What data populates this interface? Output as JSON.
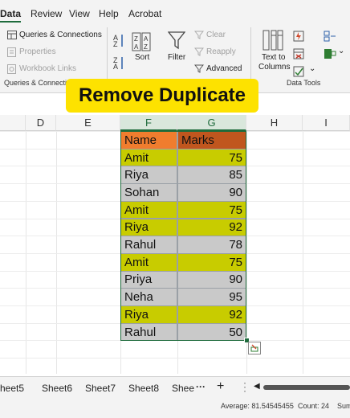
{
  "menu": [
    "Data",
    "Review",
    "View",
    "Help",
    "Acrobat"
  ],
  "ribbon": {
    "queries_connections": "Queries & Connections",
    "properties": "Properties",
    "workbook_links": "Workbook Links",
    "group_queries": "Queries & Connectio",
    "sort": "Sort",
    "filter": "Filter",
    "clear": "Clear",
    "reapply": "Reapply",
    "advanced": "Advanced",
    "text_to": "Text to",
    "columns": "Columns",
    "group_data_tools": "Data Tools",
    "az_top": "A\nZ",
    "za_top": "Z\nA"
  },
  "banner": "Remove Duplicate",
  "columns": [
    "D",
    "E",
    "F",
    "G",
    "H",
    "I"
  ],
  "table": {
    "header_name": "Name",
    "header_marks": "Marks",
    "rows": [
      {
        "name": "Amit",
        "marks": "75",
        "duplicate": true
      },
      {
        "name": "Riya",
        "marks": "85",
        "duplicate": false
      },
      {
        "name": "Sohan",
        "marks": "90",
        "duplicate": false
      },
      {
        "name": "Amit",
        "marks": "75",
        "duplicate": true
      },
      {
        "name": "Riya",
        "marks": "92",
        "duplicate": true
      },
      {
        "name": "Rahul",
        "marks": "78",
        "duplicate": false
      },
      {
        "name": "Amit",
        "marks": "75",
        "duplicate": true
      },
      {
        "name": "Priya",
        "marks": "90",
        "duplicate": false
      },
      {
        "name": "Neha",
        "marks": "95",
        "duplicate": false
      },
      {
        "name": "Riya",
        "marks": "92",
        "duplicate": true
      },
      {
        "name": "Rahul",
        "marks": "50",
        "duplicate": false
      }
    ]
  },
  "sheets": [
    "heet5",
    "Sheet6",
    "Sheet7",
    "Sheet8",
    "Shee"
  ],
  "sheet_more": "···",
  "sheet_add": "+",
  "status": {
    "average": "Average: 81.54545455",
    "count": "Count: 24",
    "sum": "Sum"
  },
  "colors": {
    "accent": "#1e6b3c",
    "header_name_fill": "#f07d2e",
    "header_marks_fill": "#c0561e",
    "dup_fill": "#c8cc00",
    "plain_fill": "#c9c9c9",
    "banner": "#fde200"
  }
}
